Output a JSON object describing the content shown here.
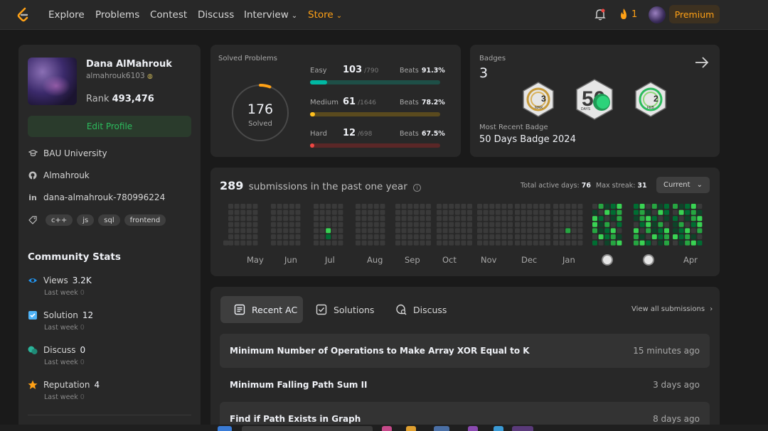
{
  "nav": {
    "links": [
      "Explore",
      "Problems",
      "Contest",
      "Discuss",
      "Interview",
      "Store"
    ],
    "streak": "1",
    "premium": "Premium"
  },
  "profile": {
    "name": "Dana AlMahrouk",
    "handle": "almahrouk6103",
    "rank_label": "Rank",
    "rank": "493,476",
    "edit_button": "Edit Profile",
    "university": "BAU University",
    "github": "Almahrouk",
    "linkedin": "dana-almahrouk-780996224",
    "skills": [
      "c++",
      "js",
      "sql",
      "frontend"
    ]
  },
  "community": {
    "title": "Community Stats",
    "items": [
      {
        "label": "Views",
        "value": "3.2K",
        "sub": "Last week",
        "delta": "0",
        "icon": "eye-icon",
        "color": "#2196f3"
      },
      {
        "label": "Solution",
        "value": "12",
        "sub": "Last week",
        "delta": "0",
        "icon": "check-square-icon",
        "color": "#4fb3f6"
      },
      {
        "label": "Discuss",
        "value": "0",
        "sub": "Last week",
        "delta": "0",
        "icon": "chat-icon",
        "color": "#2bb49a"
      },
      {
        "label": "Reputation",
        "value": "4",
        "sub": "Last week",
        "delta": "0",
        "icon": "star-icon",
        "color": "#ffa116"
      }
    ]
  },
  "solved": {
    "title": "Solved Problems",
    "total": "176",
    "total_label": "Solved",
    "difficulties": [
      {
        "label": "Easy",
        "solved": "103",
        "total": "/790",
        "beats_label": "Beats",
        "beats": "91.3%",
        "ratio": 0.13,
        "color": "#00b8a3",
        "track": "#1e4f47"
      },
      {
        "label": "Medium",
        "solved": "61",
        "total": "/1646",
        "beats_label": "Beats",
        "beats": "78.2%",
        "ratio": 0.037,
        "color": "#ffc01e",
        "track": "#5a4a1e"
      },
      {
        "label": "Hard",
        "solved": "12",
        "total": "/698",
        "beats_label": "Beats",
        "beats": "67.5%",
        "ratio": 0.017,
        "color": "#ef4743",
        "track": "#5a2727"
      }
    ]
  },
  "badges": {
    "title": "Badges",
    "count": "3",
    "recent_label": "Most Recent Badge",
    "recent": "50 Days Badge 2024",
    "items": [
      {
        "num": "3",
        "sub": "MAR",
        "icon": "mar-badge-icon"
      },
      {
        "num": "50",
        "sub": "DAYS",
        "icon": "fifty-days-badge-icon"
      },
      {
        "num": "2",
        "sub": "FEB",
        "icon": "feb-badge-icon"
      }
    ]
  },
  "calendar": {
    "count": "289",
    "title": "submissions in the past one year",
    "active_label": "Total active days:",
    "active": "76",
    "streak_label": "Max streak:",
    "streak": "31",
    "select": "Current",
    "months": [
      "May",
      "Jun",
      "Jul",
      "Aug",
      "Sep",
      "Oct",
      "Nov",
      "Dec",
      "Jan",
      "Feb",
      "Mar",
      "Apr"
    ]
  },
  "submissions": {
    "tabs": [
      "Recent AC",
      "Solutions",
      "Discuss"
    ],
    "view_all": "View all submissions",
    "rows": [
      {
        "title": "Minimum Number of Operations to Make Array XOR Equal to K",
        "time": "15 minutes ago"
      },
      {
        "title": "Minimum Falling Path Sum II",
        "time": "3 days ago"
      },
      {
        "title": "Find if Path Exists in Graph",
        "time": "8 days ago"
      }
    ]
  }
}
